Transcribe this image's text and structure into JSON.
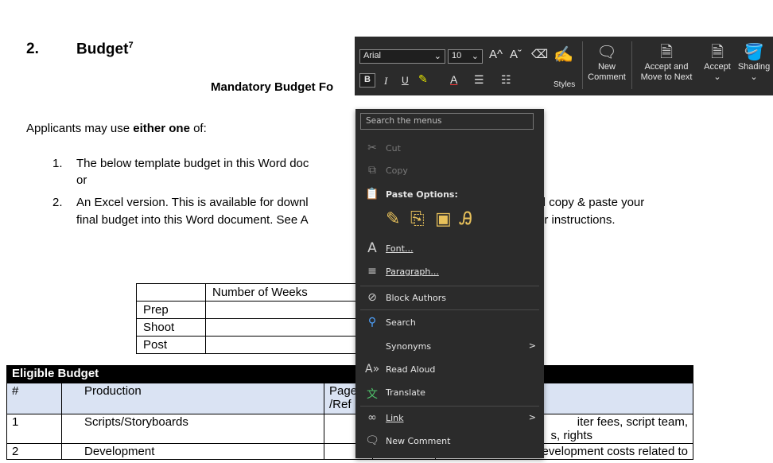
{
  "document": {
    "heading_number": "2.",
    "heading_text": "Budget",
    "heading_sup": "7",
    "mandatory_title": "Mandatory Budget Fo",
    "intro_pre": "Applicants may use ",
    "intro_bold": "either one",
    "intro_post": " of:",
    "list": [
      {
        "num": "1.",
        "line1": "The below template budget in this Word doc",
        "line2": "or"
      },
      {
        "num": "2.",
        "line1": "An Excel version. This is available for downl",
        "line1b": "and copy & paste your",
        "line2": "final budget into this Word document. See A",
        "line2b": "or instructions."
      }
    ],
    "weeks_table": {
      "header": "Number of Weeks",
      "rows": [
        "Prep",
        "Shoot",
        "Post"
      ]
    },
    "budget_table": {
      "title": "Eligible Budget",
      "col_hash": "#",
      "col_production": "Production",
      "col_page_ref_1": "Page",
      "col_page_ref_2": "/Ref",
      "rows": [
        {
          "num": "1",
          "production": "Scripts/Storyboards",
          "notes1": "iter fees, script team,",
          "notes2": "s, rights"
        },
        {
          "num": "2",
          "production": "Development",
          "notes1": "Incurred development costs related to"
        }
      ]
    }
  },
  "ribbon": {
    "font_name": "Arial",
    "font_size": "10",
    "styles_label": "Styles",
    "new_comment_label_1": "New",
    "new_comment_label_2": "Comment",
    "accept_move_label_1": "Accept and",
    "accept_move_label_2": "Move to Next",
    "accept_label": "Accept",
    "shading_label": "Shading",
    "bold": "B",
    "italic": "I",
    "underline": "U",
    "grow": "A^",
    "shrink": "Aˇ",
    "font_color": "A"
  },
  "context_menu": {
    "search_placeholder": "Search the menus",
    "items": [
      {
        "icon": "cut-icon",
        "label": "Cut"
      },
      {
        "icon": "copy-icon",
        "label": "Copy"
      },
      {
        "icon": "paste-icon",
        "label": "Paste Options:"
      },
      {
        "icon": "font-icon",
        "label": "Font..."
      },
      {
        "icon": "paragraph-icon",
        "label": "Paragraph..."
      },
      {
        "icon": "block-authors-icon",
        "label": "Block Authors"
      },
      {
        "icon": "search-icon",
        "label": "Search"
      },
      {
        "icon": "",
        "label": "Synonyms",
        "arrow": ">"
      },
      {
        "icon": "read-aloud-icon",
        "label": "Read Aloud"
      },
      {
        "icon": "translate-icon",
        "label": "Translate"
      },
      {
        "icon": "link-icon",
        "label": "Link",
        "arrow": ">"
      },
      {
        "icon": "new-comment-icon",
        "label": "New Comment"
      }
    ]
  },
  "colors": {
    "menu_bg": "#2b2b2b",
    "table_header_bg": "#000000",
    "column_header_bg": "#dae3f3",
    "paste_icon": "#e8c15b"
  }
}
